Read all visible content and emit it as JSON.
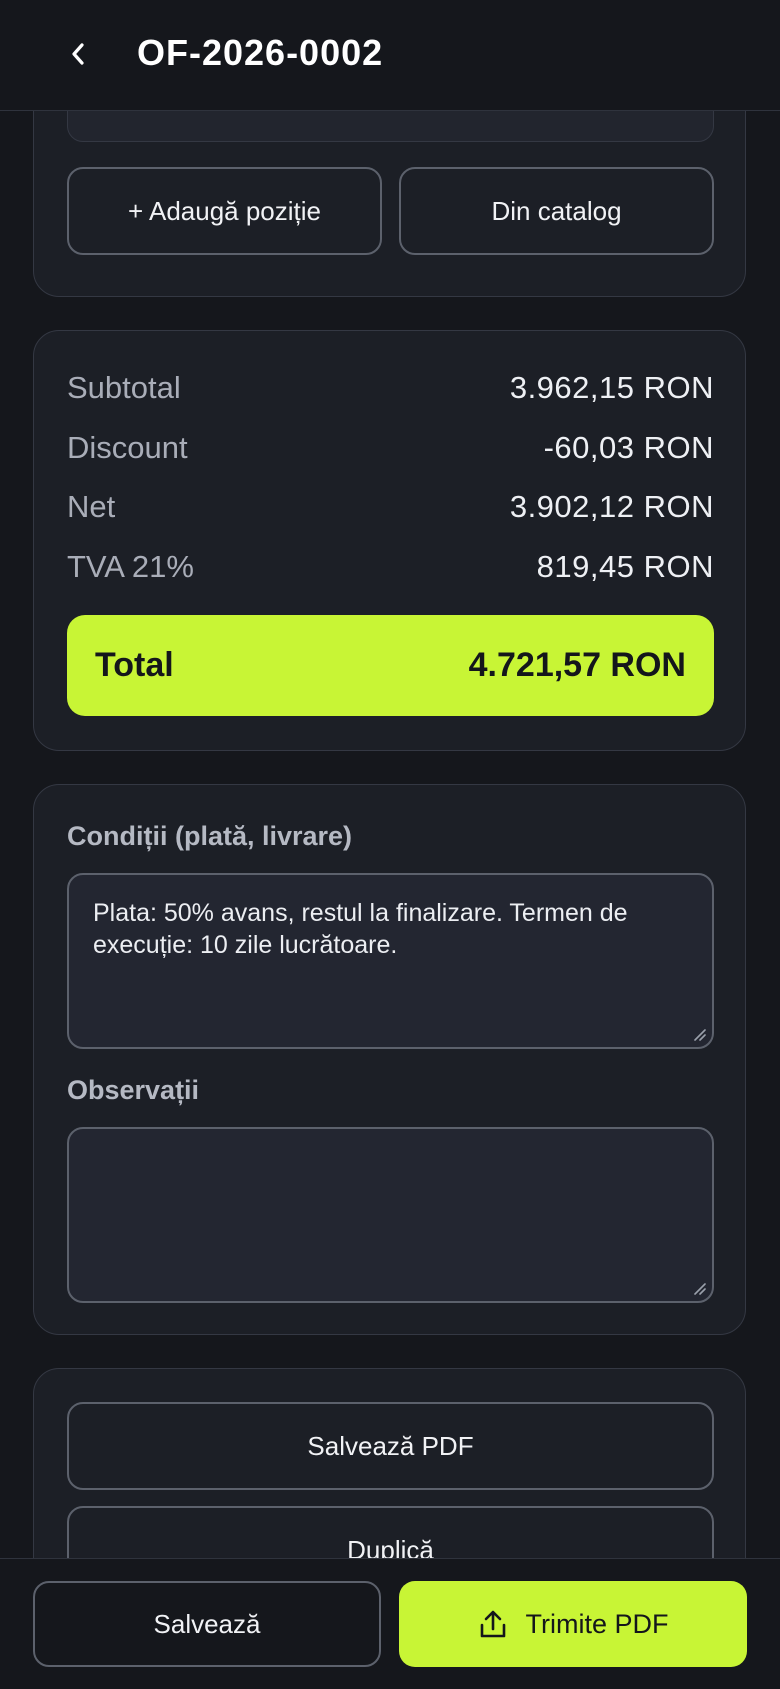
{
  "header": {
    "title": "OF-2026-0002"
  },
  "items_actions": {
    "add_label": "+ Adaugă poziție",
    "catalog_label": "Din catalog"
  },
  "totals": {
    "rows": [
      {
        "label": "Subtotal",
        "value": "3.962,15 RON"
      },
      {
        "label": "Discount",
        "value": "-60,03 RON"
      },
      {
        "label": "Net",
        "value": "3.902,12 RON"
      },
      {
        "label": "TVA 21%",
        "value": "819,45 RON"
      }
    ],
    "total_label": "Total",
    "total_value": "4.721,57 RON",
    "accent_color": "#c8f535"
  },
  "conditions": {
    "label": "Condiții (plată, livrare)",
    "value": "Plata: 50% avans, restul la finalizare. Termen de execuție: 10 zile lucrătoare."
  },
  "observations": {
    "label": "Observații",
    "value": ""
  },
  "actions": {
    "save_pdf_label": "Salvează PDF",
    "duplicate_label": "Duplică"
  },
  "bottom_bar": {
    "save_label": "Salvează",
    "send_pdf_label": "Trimite PDF",
    "send_icon": "share-upload-icon"
  }
}
